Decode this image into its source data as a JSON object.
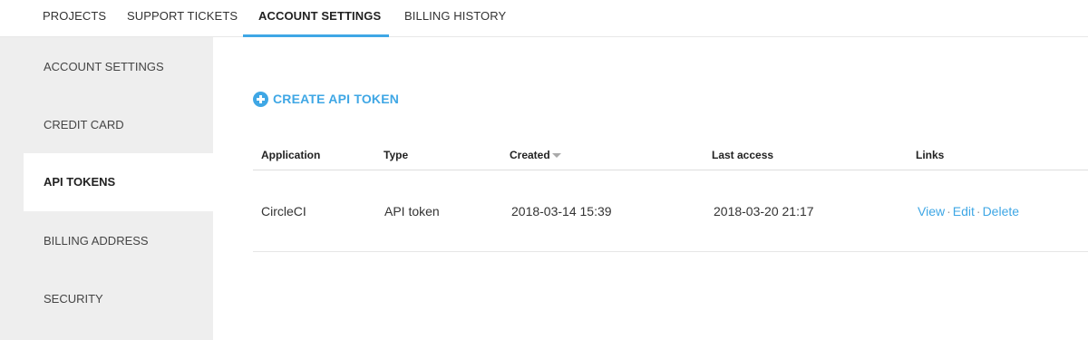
{
  "topnav": {
    "tabs": [
      {
        "label": "PROJECTS"
      },
      {
        "label": "SUPPORT TICKETS"
      },
      {
        "label": "ACCOUNT SETTINGS"
      },
      {
        "label": "BILLING HISTORY"
      }
    ],
    "active_tab": "ACCOUNT SETTINGS"
  },
  "sidebar": {
    "items": [
      {
        "label": "ACCOUNT SETTINGS"
      },
      {
        "label": "CREDIT CARD"
      },
      {
        "label": "API TOKENS"
      },
      {
        "label": "BILLING ADDRESS"
      },
      {
        "label": "SECURITY"
      }
    ],
    "active_item": "API TOKENS"
  },
  "main": {
    "create_button_label": "CREATE API TOKEN",
    "table": {
      "columns": [
        "Application",
        "Type",
        "Created",
        "Last access",
        "Links"
      ],
      "sort_icon": "caret-down-icon",
      "rows": [
        {
          "application": "CircleCI",
          "type": "API token",
          "created": "2018-03-14 15:39",
          "last_access": "2018-03-20 21:17",
          "links": [
            "View",
            "Edit",
            "Delete"
          ],
          "link_separator": "·"
        }
      ]
    }
  },
  "colors": {
    "accent": "#3fa7e5",
    "sidebar_bg": "#eeeeee",
    "text": "#333333"
  }
}
